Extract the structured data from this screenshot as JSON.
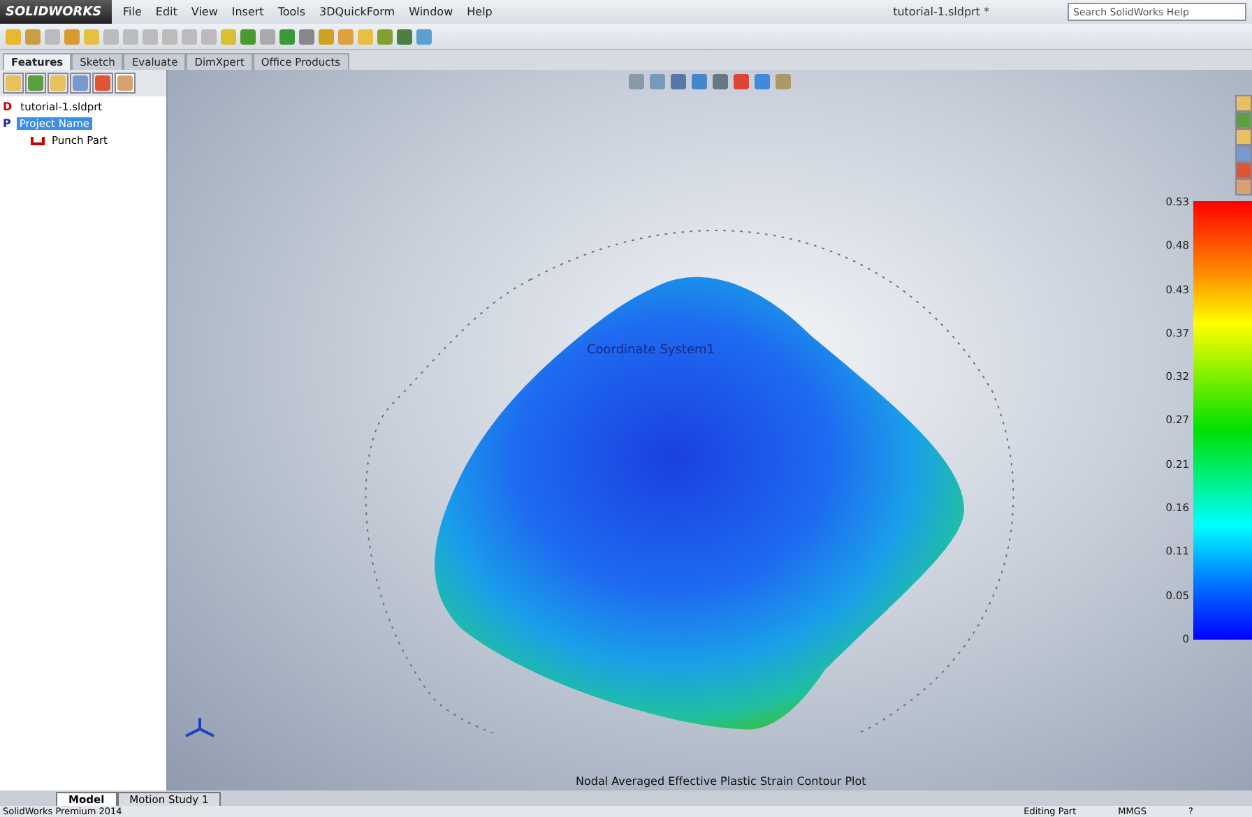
{
  "title_bar": {
    "brand": "SOLIDWORKS",
    "menu": [
      "File",
      "Edit",
      "View",
      "Insert",
      "Tools",
      "3DQuickForm",
      "Window",
      "Help"
    ],
    "document": "tutorial-1.sldprt *",
    "search": {
      "placeholder": "Search SolidWorks Help"
    }
  },
  "command_tabs": [
    {
      "label": "Features",
      "selected": true
    },
    {
      "label": "Sketch",
      "selected": false
    },
    {
      "label": "Evaluate",
      "selected": false
    },
    {
      "label": "DimXpert",
      "selected": false
    },
    {
      "label": "Office Products",
      "selected": false
    }
  ],
  "panel_tabs": [
    {
      "selected": false
    },
    {
      "selected": false
    },
    {
      "selected": false
    },
    {
      "selected": false
    },
    {
      "selected": false
    },
    {
      "selected": true
    }
  ],
  "tree": [
    {
      "badge": "D",
      "label": "tutorial-1.sldprt",
      "selected": false
    },
    {
      "badge": "P",
      "label": "Project Name",
      "selected": true,
      "children": [
        {
          "label": "Punch Part",
          "selected": false
        }
      ]
    }
  ],
  "viewport": {
    "coordinate_label": "Coordinate System1",
    "caption": "Nodal Averaged Effective Plastic Strain Contour Plot",
    "legend": [
      "0.53",
      "0.48",
      "0.43",
      "0.37",
      "0.32",
      "0.27",
      "0.21",
      "0.16",
      "0.11",
      "0.05",
      "0"
    ]
  },
  "bottom_tabs": [
    {
      "label": "Model",
      "selected": true
    },
    {
      "label": "Motion Study 1",
      "selected": false
    }
  ],
  "status_bar": {
    "product": "SolidWorks Premium 2014",
    "mode": "Editing Part",
    "units": "MMGS",
    "help": "?"
  }
}
